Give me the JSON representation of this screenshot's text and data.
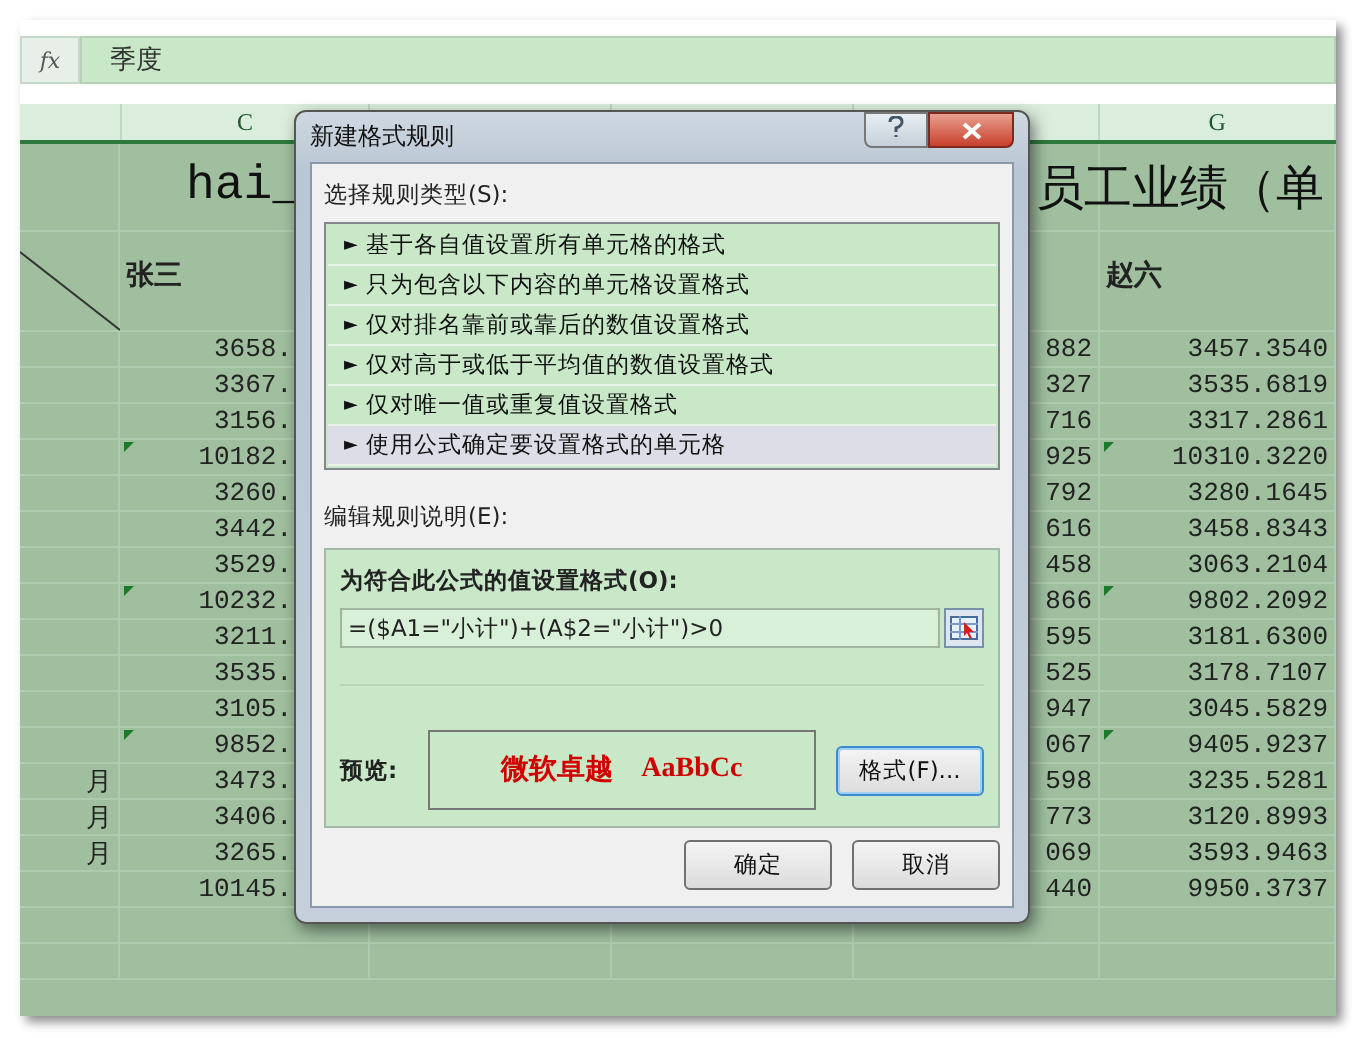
{
  "formula_bar": {
    "fx_label": "fx",
    "value": "季度"
  },
  "columns": [
    {
      "letter": "C"
    },
    {
      "letter": "G"
    }
  ],
  "title": {
    "left": "hai_",
    "right": "员工业绩（单"
  },
  "headers": {
    "column_c": "张三",
    "column_g": "赵六"
  },
  "rows": [
    {
      "column_a": "",
      "column_c": "3658.",
      "column_f": "882",
      "column_g": "3457.3540",
      "flagged": false
    },
    {
      "column_a": "",
      "column_c": "3367.",
      "column_f": "327",
      "column_g": "3535.6819",
      "flagged": false
    },
    {
      "column_a": "",
      "column_c": "3156.",
      "column_f": "716",
      "column_g": "3317.2861",
      "flagged": false
    },
    {
      "column_a": "",
      "column_c": "10182.",
      "column_f": "925",
      "column_g": "10310.3220",
      "flagged": true
    },
    {
      "column_a": "",
      "column_c": "3260.",
      "column_f": "792",
      "column_g": "3280.1645",
      "flagged": false
    },
    {
      "column_a": "",
      "column_c": "3442.",
      "column_f": "616",
      "column_g": "3458.8343",
      "flagged": false
    },
    {
      "column_a": "",
      "column_c": "3529.",
      "column_f": "458",
      "column_g": "3063.2104",
      "flagged": false
    },
    {
      "column_a": "",
      "column_c": "10232.",
      "column_f": "866",
      "column_g": "9802.2092",
      "flagged": true
    },
    {
      "column_a": "",
      "column_c": "3211.",
      "column_f": "595",
      "column_g": "3181.6300",
      "flagged": false
    },
    {
      "column_a": "",
      "column_c": "3535.",
      "column_f": "525",
      "column_g": "3178.7107",
      "flagged": false
    },
    {
      "column_a": "",
      "column_c": "3105.",
      "column_f": "947",
      "column_g": "3045.5829",
      "flagged": false
    },
    {
      "column_a": "",
      "column_c": "9852.",
      "column_f": "067",
      "column_g": "9405.9237",
      "flagged": true
    },
    {
      "column_a": "月",
      "column_c": "3473.",
      "column_f": "598",
      "column_g": "3235.5281",
      "flagged": false
    },
    {
      "column_a": "月",
      "column_c": "3406.",
      "column_f": "773",
      "column_g": "3120.8993",
      "flagged": false
    },
    {
      "column_a": "月",
      "column_c": "3265.",
      "column_f": "069",
      "column_g": "3593.9463",
      "flagged": false
    },
    {
      "column_a": "",
      "column_c": "10145.",
      "column_f": "440",
      "column_g": "9950.3737",
      "flagged": false
    }
  ],
  "dialog": {
    "title": "新建格式规则",
    "rule_type_label": "选择规则类型(S):",
    "rule_types": [
      {
        "label": "基于各自值设置所有单元格的格式",
        "selected": false
      },
      {
        "label": "只为包含以下内容的单元格设置格式",
        "selected": false
      },
      {
        "label": "仅对排名靠前或靠后的数值设置格式",
        "selected": false
      },
      {
        "label": "仅对高于或低于平均值的数值设置格式",
        "selected": false
      },
      {
        "label": "仅对唯一值或重复值设置格式",
        "selected": false
      },
      {
        "label": "使用公式确定要设置格式的单元格",
        "selected": true
      }
    ],
    "arrow": "►",
    "description_label": "编辑规则说明(E):",
    "formula_label": "为符合此公式的值设置格式(O):",
    "formula": "=($A1=\"小计\")+(A$2=\"小计\")>0",
    "preview_label": "预览:",
    "preview_cn": "微软卓越",
    "preview_en": "AaBbCc",
    "format_button": "格式(F)...",
    "ok_button": "确定",
    "cancel_button": "取消"
  }
}
